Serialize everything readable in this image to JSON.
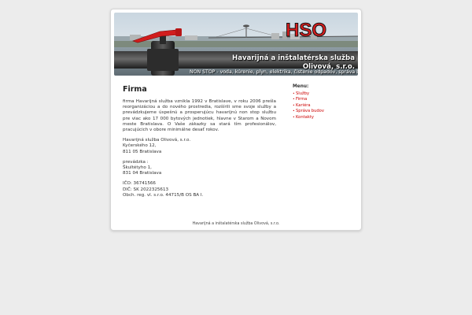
{
  "header": {
    "logo_text": "HSO",
    "title_line1": "Havarijná a inštalatérska služba",
    "title_line2": "Olivová, s.r.o.",
    "subtitle": "NON STOP - voda, kúrenie, plyn, elektrika, čistenie odpadov, správa budov"
  },
  "content": {
    "heading": "Firma",
    "intro": "firma Havarijná služba vznikla 1992 v Bratislave, v roku 2006 prešla reorganizáciou a do nového prostredia, rozšírili sme svoje služby a prevádzkujeme úspešnú a prosperujúcu havarijnú non stop službu pre viac ako 17 000 bytových jednotiek, hlavne v Starom a Novom meste Bratislava. O Vaše zákazky sa stará tím profesionálov, pracujúcich v obore minimálne desať rokov.",
    "address_lines": [
      "Havarijná služba Olivová, s.r.o.",
      "Kyčerského 12,",
      "811 05 Bratislava"
    ],
    "branch_lines": [
      "prevádzka :",
      "Škultétyho 1,",
      "831 04 Bratislava"
    ],
    "ids_lines": [
      "IČO: 36741566",
      "DIČ: SK 2022325613",
      "Obch. reg. vl. s.r.o. 44715/B OS BA I."
    ]
  },
  "menu": {
    "title": "Menu:",
    "items": [
      "Služby",
      "Firma",
      "Kariéra",
      "Správa budov",
      "Kontakty"
    ]
  },
  "footer": {
    "text": "Havarijná a inštalatérska služba Olivová, s.r.o."
  },
  "colors": {
    "accent": "#cc0000",
    "logo": "#d81e1e",
    "background": "#ececec"
  }
}
